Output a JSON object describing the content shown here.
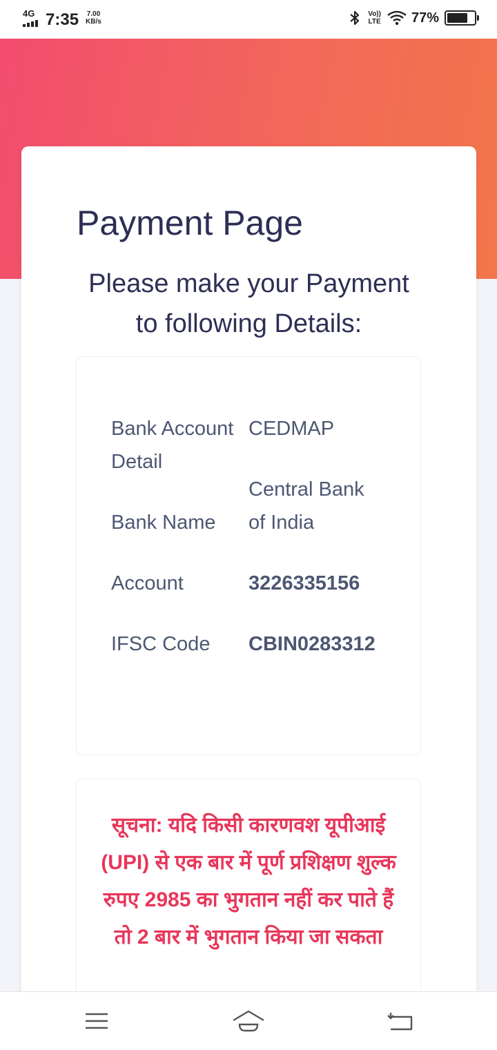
{
  "status_bar": {
    "network": "4G",
    "time": "7:35",
    "speed_value": "7.00",
    "speed_unit": "KB/s",
    "volte_top": "Vo))",
    "volte_bottom": "LTE",
    "battery_percent": "77%",
    "battery_level": 0.77
  },
  "page": {
    "title": "Payment Page",
    "subtitle_line1": "Please make your Payment",
    "subtitle_line2": "to following Details:"
  },
  "bank_details": [
    {
      "label": "Bank Account Detail",
      "value": "CEDMAP"
    },
    {
      "label": "Bank Name",
      "value": "Central Bank of India"
    },
    {
      "label": "Account",
      "value": "3226335156"
    },
    {
      "label": "IFSC Code",
      "value": "CBIN0283312"
    }
  ],
  "notice": {
    "text": "सूचना: यदि किसी कारणवश यूपीआई (UPI) से एक बार में पूर्ण प्रशिक्षण शुल्क रुपए 2985 का भुगतान नहीं कर पाते हैं तो 2 बार में भुगतान किया जा सकता"
  },
  "colors": {
    "gradient_start": "#f24c6e",
    "gradient_end": "#f2764a",
    "title_color": "#2d2f55",
    "notice_color": "#e8365b"
  },
  "nav_icons": [
    "menu-icon",
    "home-icon",
    "back-icon"
  ]
}
